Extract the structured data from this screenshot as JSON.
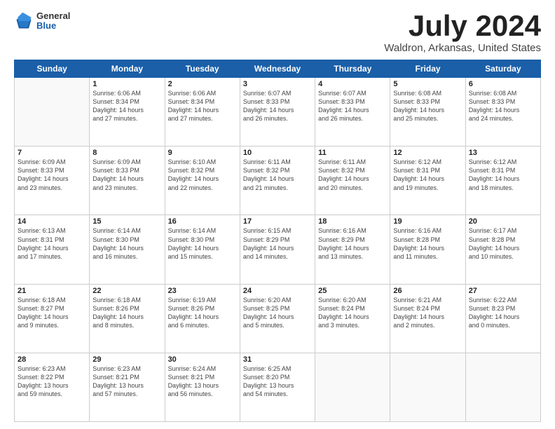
{
  "header": {
    "logo_general": "General",
    "logo_blue": "Blue",
    "title": "July 2024",
    "location": "Waldron, Arkansas, United States"
  },
  "days_of_week": [
    "Sunday",
    "Monday",
    "Tuesday",
    "Wednesday",
    "Thursday",
    "Friday",
    "Saturday"
  ],
  "weeks": [
    [
      {
        "day": "",
        "info": ""
      },
      {
        "day": "1",
        "info": "Sunrise: 6:06 AM\nSunset: 8:34 PM\nDaylight: 14 hours\nand 27 minutes."
      },
      {
        "day": "2",
        "info": "Sunrise: 6:06 AM\nSunset: 8:34 PM\nDaylight: 14 hours\nand 27 minutes."
      },
      {
        "day": "3",
        "info": "Sunrise: 6:07 AM\nSunset: 8:33 PM\nDaylight: 14 hours\nand 26 minutes."
      },
      {
        "day": "4",
        "info": "Sunrise: 6:07 AM\nSunset: 8:33 PM\nDaylight: 14 hours\nand 26 minutes."
      },
      {
        "day": "5",
        "info": "Sunrise: 6:08 AM\nSunset: 8:33 PM\nDaylight: 14 hours\nand 25 minutes."
      },
      {
        "day": "6",
        "info": "Sunrise: 6:08 AM\nSunset: 8:33 PM\nDaylight: 14 hours\nand 24 minutes."
      }
    ],
    [
      {
        "day": "7",
        "info": "Sunrise: 6:09 AM\nSunset: 8:33 PM\nDaylight: 14 hours\nand 23 minutes."
      },
      {
        "day": "8",
        "info": "Sunrise: 6:09 AM\nSunset: 8:33 PM\nDaylight: 14 hours\nand 23 minutes."
      },
      {
        "day": "9",
        "info": "Sunrise: 6:10 AM\nSunset: 8:32 PM\nDaylight: 14 hours\nand 22 minutes."
      },
      {
        "day": "10",
        "info": "Sunrise: 6:11 AM\nSunset: 8:32 PM\nDaylight: 14 hours\nand 21 minutes."
      },
      {
        "day": "11",
        "info": "Sunrise: 6:11 AM\nSunset: 8:32 PM\nDaylight: 14 hours\nand 20 minutes."
      },
      {
        "day": "12",
        "info": "Sunrise: 6:12 AM\nSunset: 8:31 PM\nDaylight: 14 hours\nand 19 minutes."
      },
      {
        "day": "13",
        "info": "Sunrise: 6:12 AM\nSunset: 8:31 PM\nDaylight: 14 hours\nand 18 minutes."
      }
    ],
    [
      {
        "day": "14",
        "info": "Sunrise: 6:13 AM\nSunset: 8:31 PM\nDaylight: 14 hours\nand 17 minutes."
      },
      {
        "day": "15",
        "info": "Sunrise: 6:14 AM\nSunset: 8:30 PM\nDaylight: 14 hours\nand 16 minutes."
      },
      {
        "day": "16",
        "info": "Sunrise: 6:14 AM\nSunset: 8:30 PM\nDaylight: 14 hours\nand 15 minutes."
      },
      {
        "day": "17",
        "info": "Sunrise: 6:15 AM\nSunset: 8:29 PM\nDaylight: 14 hours\nand 14 minutes."
      },
      {
        "day": "18",
        "info": "Sunrise: 6:16 AM\nSunset: 8:29 PM\nDaylight: 14 hours\nand 13 minutes."
      },
      {
        "day": "19",
        "info": "Sunrise: 6:16 AM\nSunset: 8:28 PM\nDaylight: 14 hours\nand 11 minutes."
      },
      {
        "day": "20",
        "info": "Sunrise: 6:17 AM\nSunset: 8:28 PM\nDaylight: 14 hours\nand 10 minutes."
      }
    ],
    [
      {
        "day": "21",
        "info": "Sunrise: 6:18 AM\nSunset: 8:27 PM\nDaylight: 14 hours\nand 9 minutes."
      },
      {
        "day": "22",
        "info": "Sunrise: 6:18 AM\nSunset: 8:26 PM\nDaylight: 14 hours\nand 8 minutes."
      },
      {
        "day": "23",
        "info": "Sunrise: 6:19 AM\nSunset: 8:26 PM\nDaylight: 14 hours\nand 6 minutes."
      },
      {
        "day": "24",
        "info": "Sunrise: 6:20 AM\nSunset: 8:25 PM\nDaylight: 14 hours\nand 5 minutes."
      },
      {
        "day": "25",
        "info": "Sunrise: 6:20 AM\nSunset: 8:24 PM\nDaylight: 14 hours\nand 3 minutes."
      },
      {
        "day": "26",
        "info": "Sunrise: 6:21 AM\nSunset: 8:24 PM\nDaylight: 14 hours\nand 2 minutes."
      },
      {
        "day": "27",
        "info": "Sunrise: 6:22 AM\nSunset: 8:23 PM\nDaylight: 14 hours\nand 0 minutes."
      }
    ],
    [
      {
        "day": "28",
        "info": "Sunrise: 6:23 AM\nSunset: 8:22 PM\nDaylight: 13 hours\nand 59 minutes."
      },
      {
        "day": "29",
        "info": "Sunrise: 6:23 AM\nSunset: 8:21 PM\nDaylight: 13 hours\nand 57 minutes."
      },
      {
        "day": "30",
        "info": "Sunrise: 6:24 AM\nSunset: 8:21 PM\nDaylight: 13 hours\nand 56 minutes."
      },
      {
        "day": "31",
        "info": "Sunrise: 6:25 AM\nSunset: 8:20 PM\nDaylight: 13 hours\nand 54 minutes."
      },
      {
        "day": "",
        "info": ""
      },
      {
        "day": "",
        "info": ""
      },
      {
        "day": "",
        "info": ""
      }
    ]
  ]
}
